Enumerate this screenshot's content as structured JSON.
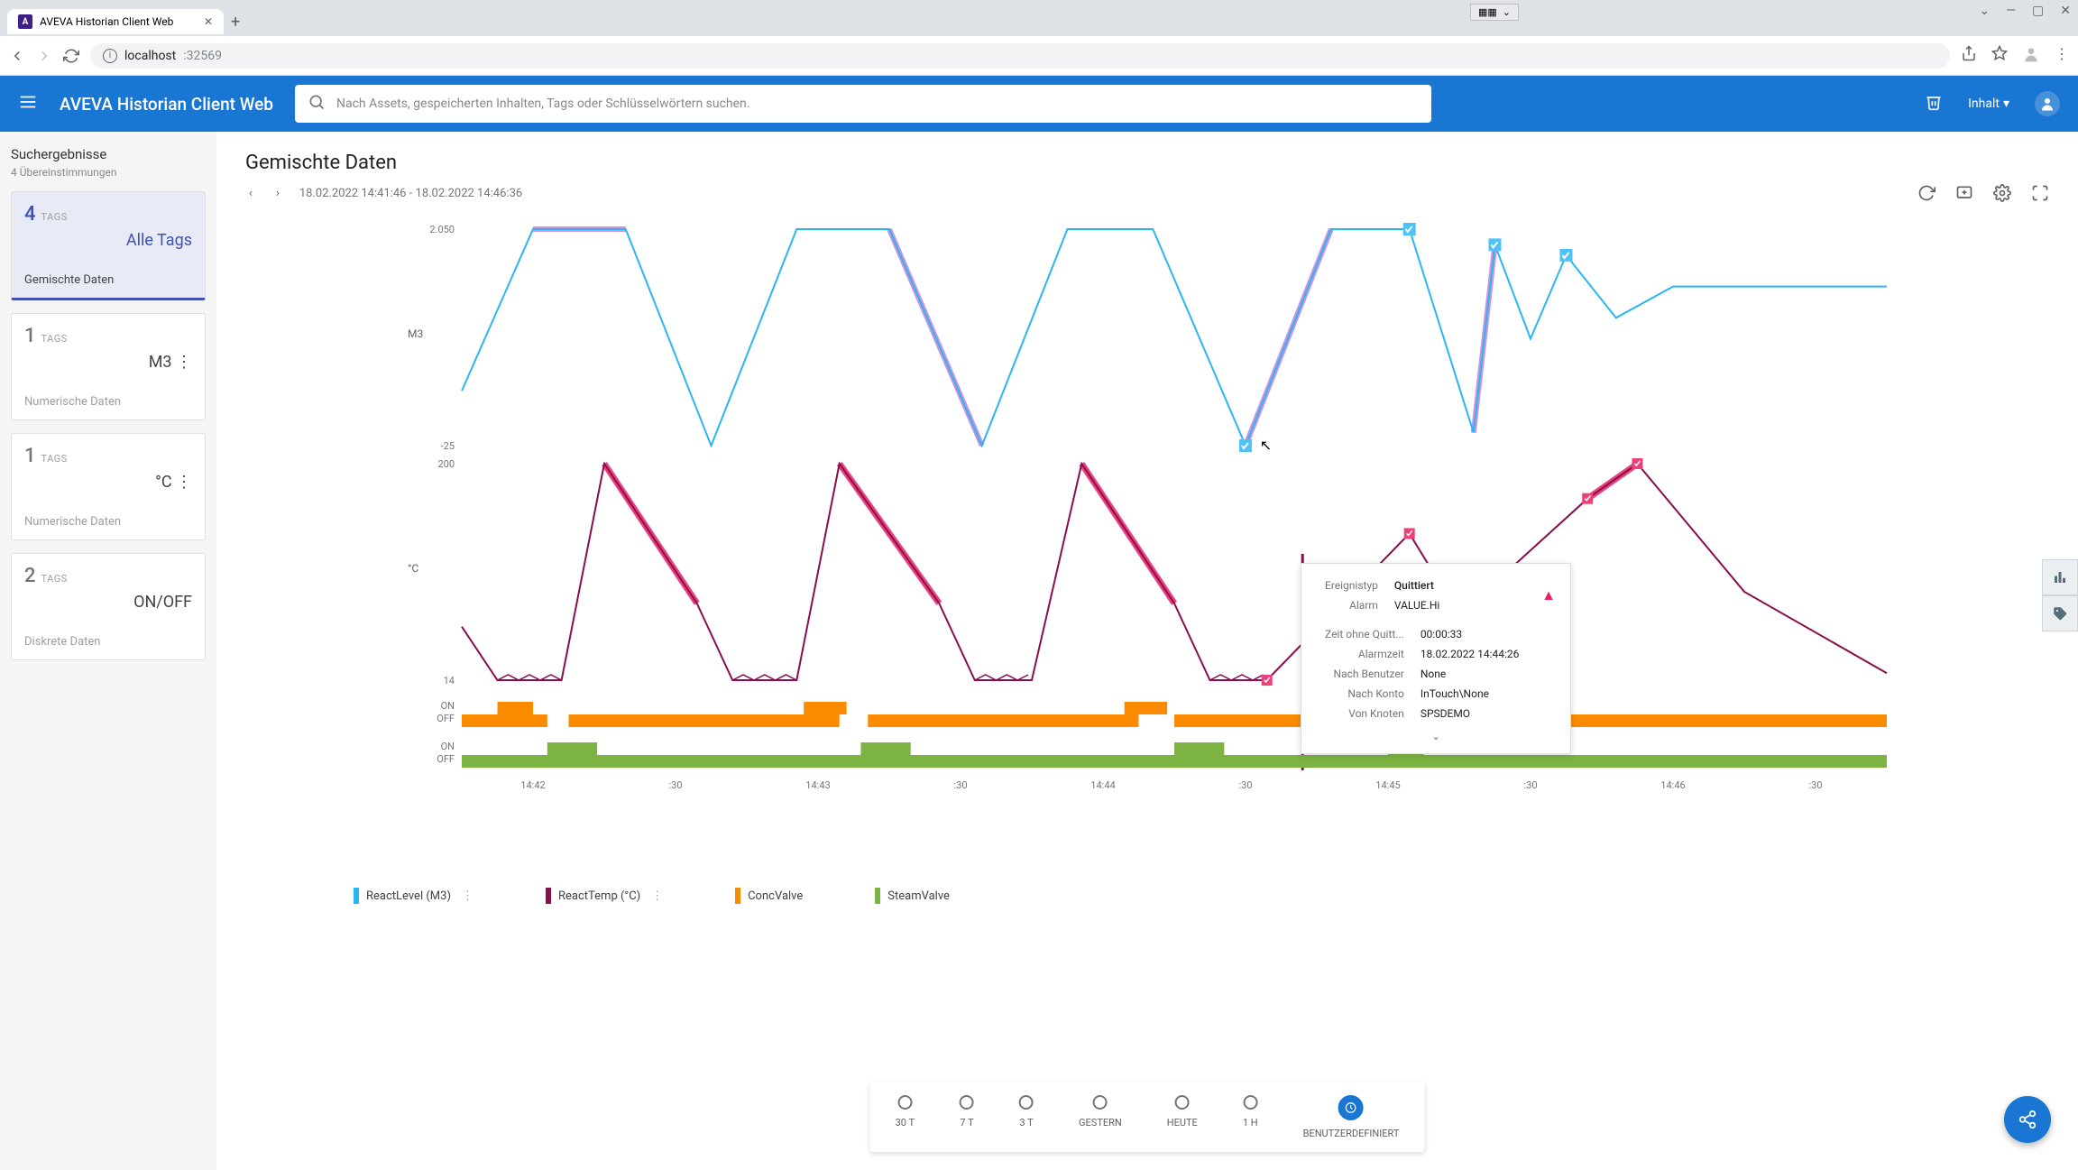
{
  "browser": {
    "tab_title": "AVEVA Historian Client Web",
    "url_host": "localhost",
    "url_port": ":32569"
  },
  "app": {
    "title": "AVEVA Historian Client Web",
    "search_placeholder": "Nach Assets, gespeicherten Inhalten, Tags oder Schlüsselwörtern suchen.",
    "content_dropdown": "Inhalt"
  },
  "sidebar": {
    "heading": "Suchergebnisse",
    "subheading": "4 Übereinstimmungen",
    "cards": [
      {
        "count": "4",
        "tags": "TAGS",
        "label": "Alle Tags",
        "chip": "Gemischte Daten",
        "active": true
      },
      {
        "count": "1",
        "tags": "TAGS",
        "label": "M3 ⋮",
        "chip": "Numerische Daten",
        "active": false
      },
      {
        "count": "1",
        "tags": "TAGS",
        "label": "°C ⋮",
        "chip": "Numerische Daten",
        "active": false
      },
      {
        "count": "2",
        "tags": "TAGS",
        "label": "ON/OFF",
        "chip": "Diskrete Daten",
        "active": false
      }
    ]
  },
  "page": {
    "title": "Gemischte Daten",
    "time_range": "18.02.2022 14:41:46 - 18.02.2022 14:46:36"
  },
  "tooltip": {
    "event_type_label": "Ereignistyp",
    "event_type": "Quittiert",
    "alarm_label": "Alarm",
    "alarm": "VALUE.Hi",
    "unack_label": "Zeit ohne Quitt...",
    "unack": "00:00:33",
    "alarm_time_label": "Alarmzeit",
    "alarm_time": "18.02.2022 14:44:26",
    "by_user_label": "Nach Benutzer",
    "by_user": "None",
    "by_account_label": "Nach Konto",
    "by_account": "InTouch\\None",
    "from_node_label": "Von Knoten",
    "from_node": "SPSDEMO"
  },
  "legend": [
    {
      "name": "ReactLevel (M3)",
      "color": "#29b6f6",
      "menu": true
    },
    {
      "name": "ReactTemp (°C)",
      "color": "#880e4f",
      "menu": true
    },
    {
      "name": "ConcValve",
      "color": "#fb8c00",
      "menu": false
    },
    {
      "name": "SteamValve",
      "color": "#7cb342",
      "menu": false
    }
  ],
  "range_picker": [
    {
      "label": "30 T"
    },
    {
      "label": "7 T"
    },
    {
      "label": "3 T"
    },
    {
      "label": "GESTERN"
    },
    {
      "label": "HEUTE"
    },
    {
      "label": "1 H"
    },
    {
      "label": "BENUTZERDEFINIERT",
      "active": true
    }
  ],
  "chart_data": [
    {
      "type": "line",
      "name": "ReactLevel",
      "unit": "M3",
      "ylim": [
        -25,
        2050
      ],
      "yticks": [
        -25,
        2050
      ],
      "x": [
        0,
        10,
        23,
        35,
        47,
        60,
        73,
        85,
        97,
        110,
        122,
        133,
        142,
        145,
        150,
        155,
        162,
        170,
        180,
        200
      ],
      "values": [
        500,
        2050,
        2050,
        -25,
        2050,
        2050,
        -25,
        2050,
        2050,
        -25,
        2050,
        2050,
        100,
        1900,
        1000,
        1800,
        1200,
        1500,
        1500,
        1500
      ],
      "highlight_segments": [
        [
          10,
          23
        ],
        [
          33,
          37
        ],
        [
          60,
          73
        ],
        [
          83,
          87
        ],
        [
          110,
          122
        ],
        [
          130,
          134
        ],
        [
          142,
          146
        ],
        [
          153,
          157
        ],
        [
          161,
          163
        ]
      ]
    },
    {
      "type": "line",
      "name": "ReactTemp",
      "unit": "°C",
      "ylim": [
        14,
        200
      ],
      "yticks": [
        14,
        200
      ],
      "x": [
        0,
        5,
        14,
        20,
        33,
        38,
        47,
        53,
        67,
        72,
        80,
        87,
        100,
        105,
        113,
        133,
        140,
        158,
        165,
        180,
        200
      ],
      "values": [
        60,
        14,
        14,
        200,
        80,
        14,
        14,
        200,
        80,
        14,
        14,
        200,
        80,
        14,
        14,
        140,
        70,
        170,
        200,
        90,
        20
      ],
      "highlight_segments": [
        [
          20,
          33
        ],
        [
          53,
          67
        ],
        [
          87,
          100
        ],
        [
          158,
          172
        ]
      ]
    },
    {
      "type": "area",
      "name": "ConcValve",
      "states": [
        "ON",
        "OFF"
      ],
      "on_ranges": [
        [
          5,
          10
        ],
        [
          48,
          54
        ],
        [
          93,
          99
        ]
      ],
      "off_ranges": [
        [
          0,
          12
        ],
        [
          15,
          53
        ],
        [
          57,
          95
        ],
        [
          100,
          200
        ]
      ]
    },
    {
      "type": "area",
      "name": "SteamValve",
      "states": [
        "ON",
        "OFF"
      ],
      "on_ranges": [
        [
          12,
          19
        ],
        [
          56,
          63
        ],
        [
          100,
          107
        ],
        [
          130,
          135
        ]
      ],
      "off_ranges": [
        [
          0,
          200
        ]
      ]
    }
  ],
  "xticks": [
    "14:42",
    ":30",
    "14:43",
    ":30",
    "14:44",
    ":30",
    "14:45",
    ":30",
    "14:46",
    ":30"
  ]
}
